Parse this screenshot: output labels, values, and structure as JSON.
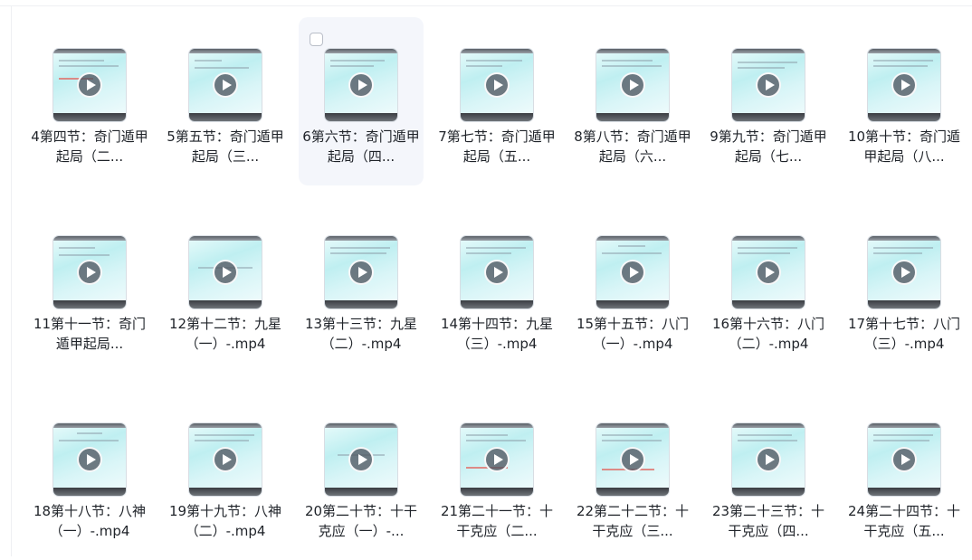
{
  "files": [
    {
      "name": "4第四节：奇门遁甲起局（二...",
      "icon": "video-play-icon"
    },
    {
      "name": "5第五节：奇门遁甲起局（三...",
      "icon": "video-play-icon"
    },
    {
      "name": "6第六节：奇门遁甲起局（四...",
      "icon": "video-play-icon",
      "selected": true
    },
    {
      "name": "7第七节：奇门遁甲起局（五...",
      "icon": "video-play-icon"
    },
    {
      "name": "8第八节：奇门遁甲起局（六...",
      "icon": "video-play-icon"
    },
    {
      "name": "9第九节：奇门遁甲起局（七...",
      "icon": "video-play-icon"
    },
    {
      "name": "10第十节：奇门遁甲起局（八...",
      "icon": "video-play-icon"
    },
    {
      "name": "11第十一节：奇门遁甲起局...",
      "icon": "video-play-icon"
    },
    {
      "name": "12第十二节：九星（一）-.mp4",
      "icon": "video-play-icon"
    },
    {
      "name": "13第十三节：九星（二）-.mp4",
      "icon": "video-play-icon"
    },
    {
      "name": "14第十四节：九星（三）-.mp4",
      "icon": "video-play-icon"
    },
    {
      "name": "15第十五节：八门（一）-.mp4",
      "icon": "video-play-icon"
    },
    {
      "name": "16第十六节：八门（二）-.mp4",
      "icon": "video-play-icon"
    },
    {
      "name": "17第十七节：八门（三）-.mp4",
      "icon": "video-play-icon"
    },
    {
      "name": "18第十八节：八神（一）-.mp4",
      "icon": "video-play-icon"
    },
    {
      "name": "19第十九节：八神（二）-.mp4",
      "icon": "video-play-icon"
    },
    {
      "name": "20第二十节：十干克应（一）-...",
      "icon": "video-play-icon"
    },
    {
      "name": "21第二十一节：十干克应（二...",
      "icon": "video-play-icon"
    },
    {
      "name": "22第二十二节：十干克应（三...",
      "icon": "video-play-icon"
    },
    {
      "name": "23第二十三节：十干克应（四...",
      "icon": "video-play-icon"
    },
    {
      "name": "24第二十四节：十干克应（五...",
      "icon": "video-play-icon"
    }
  ],
  "colors": {
    "selected_bg": "#f4f6fb",
    "text": "#1f2329"
  }
}
